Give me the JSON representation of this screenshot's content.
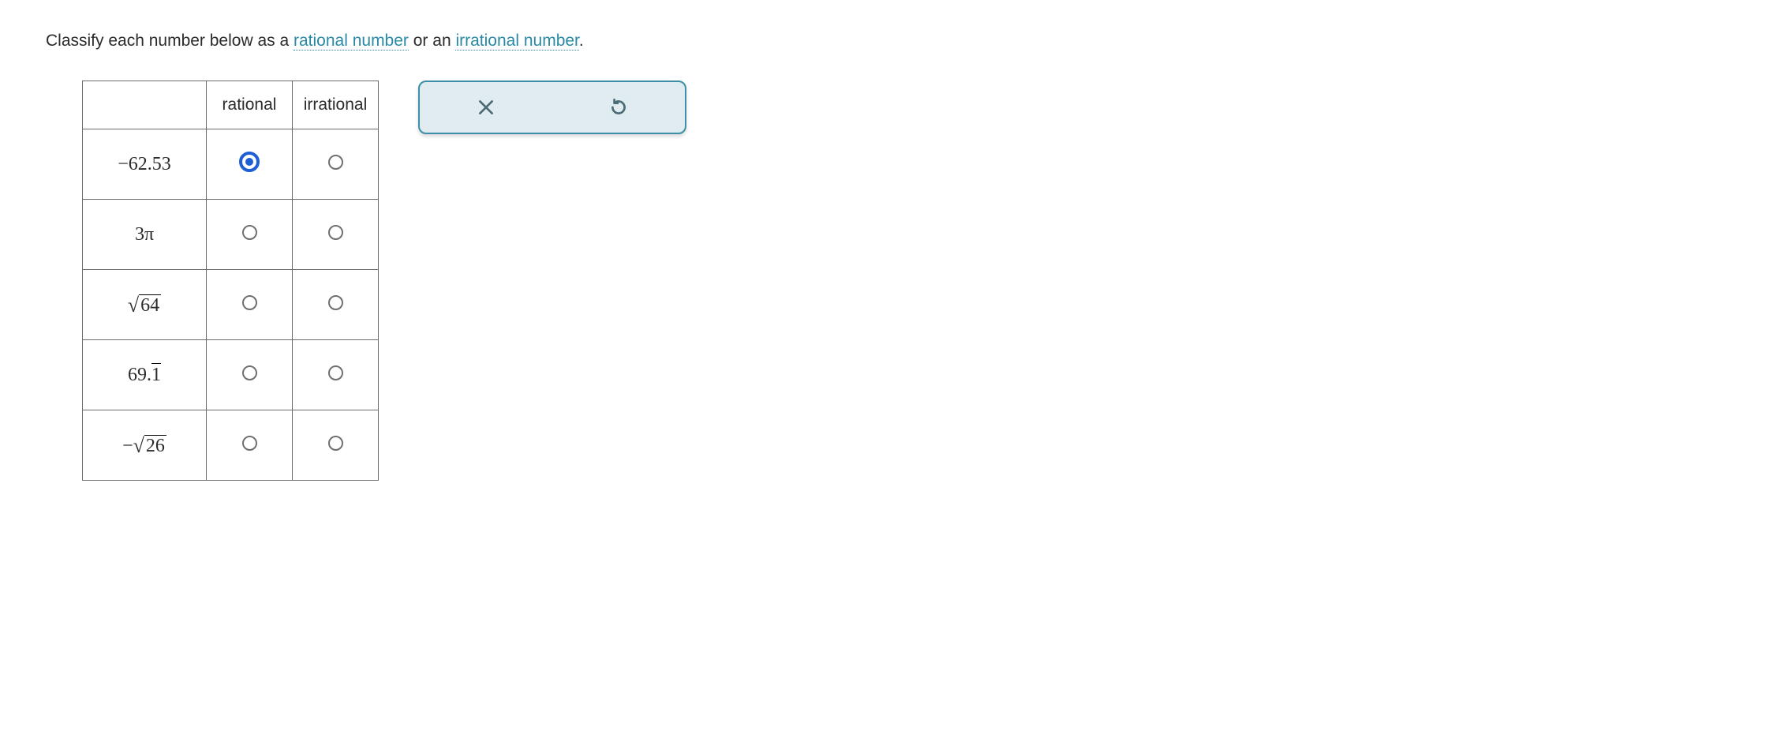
{
  "prompt": {
    "prefix": "Classify each number below as a ",
    "link1": "rational number",
    "mid": " or an ",
    "link2": "irrational number",
    "suffix": "."
  },
  "table": {
    "headers": {
      "rational": "rational",
      "irrational": "irrational"
    },
    "rows": [
      {
        "label_html": "−62.53",
        "selected": "rational"
      },
      {
        "label_html": "3π",
        "selected": null
      },
      {
        "label_html": "<span class='sqrt'><span class='radicand'>64</span></span>",
        "selected": null
      },
      {
        "label_html": "69.<span class='overline'>1</span>",
        "selected": null
      },
      {
        "label_html": "−<span class='sqrt'><span class='radicand'>26</span></span>",
        "selected": null
      }
    ]
  },
  "toolbar": {
    "clear_icon": "close-icon",
    "reset_icon": "undo-icon"
  }
}
